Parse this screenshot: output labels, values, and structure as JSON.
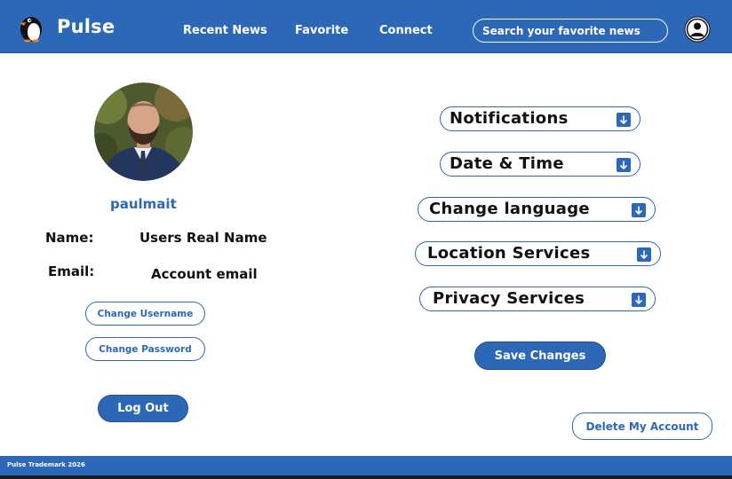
{
  "brand": {
    "name": "Pulse"
  },
  "nav": {
    "recent_news": "Recent News",
    "favorite": "Favorite",
    "connect": "Connect"
  },
  "search": {
    "placeholder": "Search your favorite news"
  },
  "profile": {
    "username": "paulmait",
    "name_label": "Name:",
    "name_value": "Users Real Name",
    "email_label": "Email:",
    "email_value": "Account email"
  },
  "account_actions": {
    "change_username": "Change Username",
    "change_password": "Change Password",
    "log_out": "Log Out",
    "delete_account": "Delete My Account"
  },
  "settings": [
    {
      "label": "Notifications"
    },
    {
      "label": "Date & Time"
    },
    {
      "label": "Change language"
    },
    {
      "label": "Location Services"
    },
    {
      "label": "Privacy Services"
    }
  ],
  "save_label": "Save Changes",
  "footer": {
    "text": "Pulse Trademark 2026"
  },
  "colors": {
    "primary": "#2d67b8",
    "text": "#111111",
    "background": "#ffffff"
  },
  "icons": {
    "logo": "penguin-icon",
    "user": "user-circle-icon",
    "dropdown": "arrow-down-icon"
  }
}
